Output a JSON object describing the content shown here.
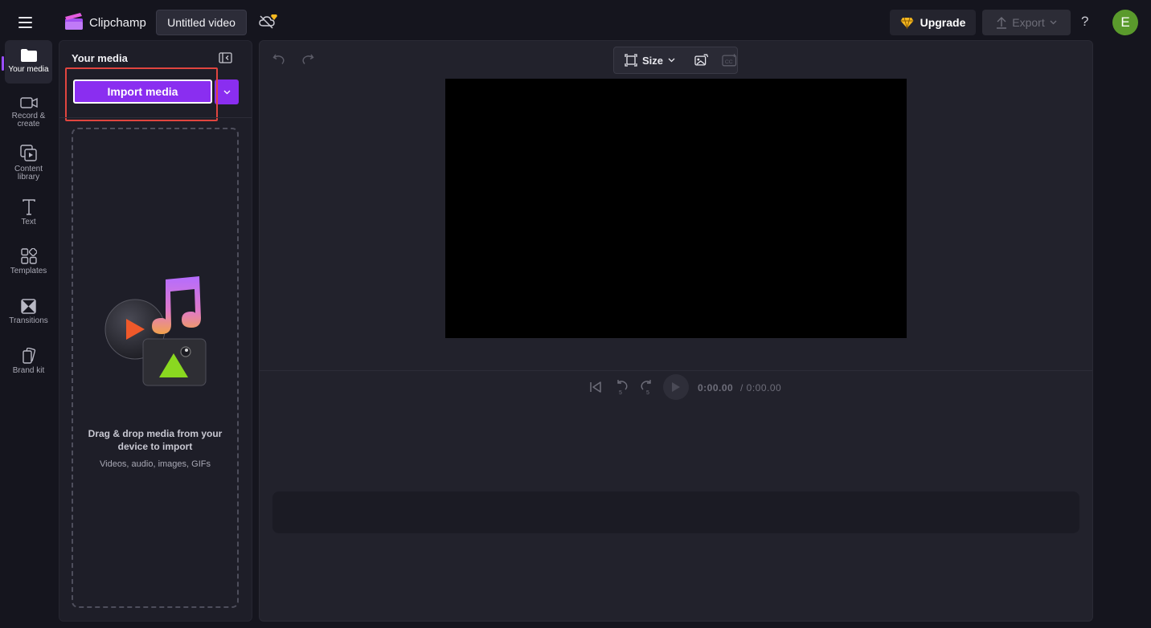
{
  "header": {
    "app_name": "Clipchamp",
    "project_title": "Untitled video",
    "upgrade_label": "Upgrade",
    "export_label": "Export",
    "help_label": "?",
    "avatar_initial": "E"
  },
  "colors": {
    "accent": "#8a2ef0",
    "highlight_border": "#e0453f",
    "avatar_bg": "#5a9a2c",
    "upgrade_diamond": "#f5b820"
  },
  "sidebar": {
    "items": [
      {
        "label": "Your media",
        "icon": "folder-icon",
        "active": true
      },
      {
        "label": "Record & create",
        "icon": "video-camera-icon",
        "active": false
      },
      {
        "label": "Content library",
        "icon": "content-library-icon",
        "active": false
      },
      {
        "label": "Text",
        "icon": "text-icon",
        "active": false
      },
      {
        "label": "Templates",
        "icon": "templates-icon",
        "active": false
      },
      {
        "label": "Transitions",
        "icon": "transitions-icon",
        "active": false
      },
      {
        "label": "Brand kit",
        "icon": "brand-kit-icon",
        "active": false
      }
    ]
  },
  "media_panel": {
    "title": "Your media",
    "import_label": "Import media",
    "drop_title": "Drag & drop media from your device to import",
    "drop_subtitle": "Videos, audio, images, GIFs"
  },
  "editor": {
    "size_label": "Size",
    "current_time": "0:00.00",
    "total_time": "/ 0:00.00"
  }
}
